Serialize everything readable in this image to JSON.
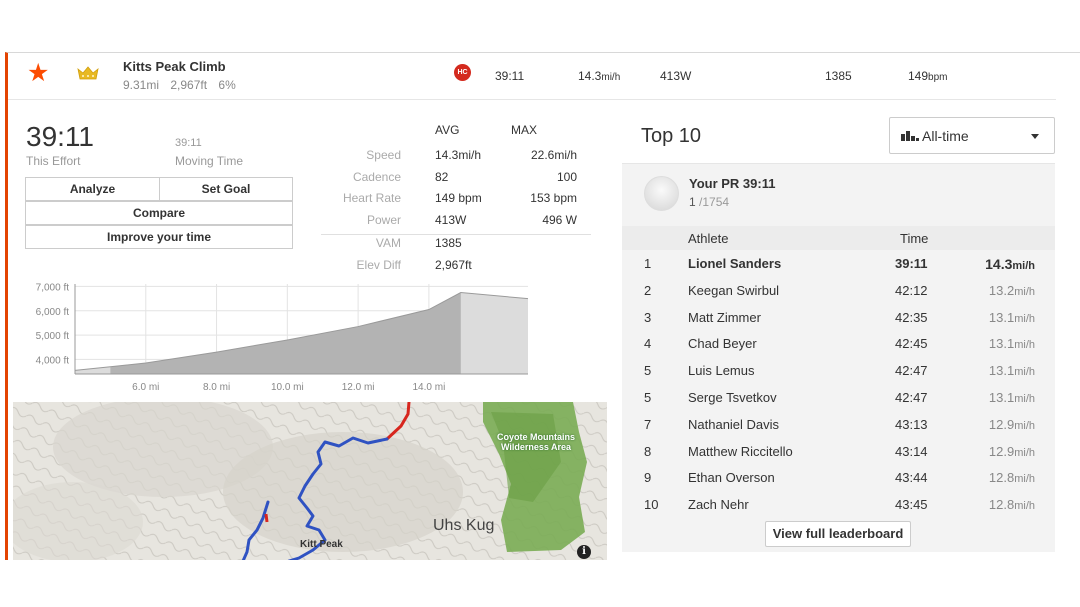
{
  "segment": {
    "name": "Kitts Peak Climb",
    "distance": "9.31mi",
    "elevation": "2,967ft",
    "grade": "6%",
    "category_badge": "HC",
    "time": "39:11",
    "speed": "14.3",
    "speed_unit": "mi/h",
    "power": "413W",
    "vam": "1385",
    "heart_rate": "149",
    "heart_rate_unit": "bpm",
    "colors": {
      "accent": "#fc4c02",
      "crown": "#e8b923",
      "hc": "#d42a1e"
    }
  },
  "effort": {
    "time": "39:11",
    "time_label": "This Effort",
    "moving_time": "39:11",
    "moving_label": "Moving Time"
  },
  "buttons": {
    "analyze": "Analyze",
    "set_goal": "Set Goal",
    "compare": "Compare",
    "improve": "Improve your time"
  },
  "stats": {
    "avg_header": "AVG",
    "max_header": "MAX",
    "rows": [
      {
        "label": "Speed",
        "avg": "14.3mi/h",
        "max": "22.6mi/h"
      },
      {
        "label": "Cadence",
        "avg": "82",
        "max": "100"
      },
      {
        "label": "Heart Rate",
        "avg": "149 bpm",
        "max": "153 bpm"
      },
      {
        "label": "Power",
        "avg": "413W",
        "max": "496 W"
      },
      {
        "label": "VAM",
        "avg": "1385",
        "max": ""
      },
      {
        "label": "Elev Diff",
        "avg": "2,967ft",
        "max": ""
      }
    ]
  },
  "chart_data": {
    "type": "area",
    "title": "",
    "xlabel": "",
    "ylabel": "",
    "y_ticks": [
      "7,000 ft",
      "6,000 ft",
      "5,000 ft",
      "4,000 ft"
    ],
    "x_ticks": [
      "6.0 mi",
      "8.0 mi",
      "10.0 mi",
      "12.0 mi",
      "14.0 mi"
    ],
    "ylim": [
      3400,
      7100
    ],
    "xlim": [
      4.0,
      16.8
    ],
    "x": [
      4.0,
      5.0,
      6.0,
      8.0,
      10.0,
      12.0,
      14.0,
      14.9,
      16.4,
      16.8
    ],
    "y": [
      3550,
      3700,
      3850,
      4300,
      4800,
      5350,
      6050,
      6750,
      6550,
      6500
    ],
    "segment_range": [
      5.0,
      14.9
    ],
    "grid": true
  },
  "map": {
    "place_label": "Uhs Kug",
    "peak_label": "Kitt Peak",
    "wilderness_label": "Coyote Mountains Wilderness Area",
    "info_icon": "info-icon"
  },
  "leaderboard": {
    "title": "Top 10",
    "range_value": "All-time",
    "pr_title": "Your PR 39:11",
    "pr_rank": "1",
    "pr_total": "/1754",
    "col_athlete": "Athlete",
    "col_time": "Time",
    "rows": [
      {
        "rank": "1",
        "name": "Lionel Sanders",
        "time": "39:11",
        "speed": "14.3",
        "unit": "mi/h"
      },
      {
        "rank": "2",
        "name": "Keegan Swirbul",
        "time": "42:12",
        "speed": "13.2",
        "unit": "mi/h"
      },
      {
        "rank": "3",
        "name": "Matt Zimmer",
        "time": "42:35",
        "speed": "13.1",
        "unit": "mi/h"
      },
      {
        "rank": "4",
        "name": "Chad Beyer",
        "time": "42:45",
        "speed": "13.1",
        "unit": "mi/h"
      },
      {
        "rank": "5",
        "name": "Luis Lemus",
        "time": "42:47",
        "speed": "13.1",
        "unit": "mi/h"
      },
      {
        "rank": "5",
        "name": "Serge Tsvetkov",
        "time": "42:47",
        "speed": "13.1",
        "unit": "mi/h"
      },
      {
        "rank": "7",
        "name": "Nathaniel Davis",
        "time": "43:13",
        "speed": "12.9",
        "unit": "mi/h"
      },
      {
        "rank": "8",
        "name": "Matthew Riccitello",
        "time": "43:14",
        "speed": "12.9",
        "unit": "mi/h"
      },
      {
        "rank": "9",
        "name": "Ethan Overson",
        "time": "43:44",
        "speed": "12.8",
        "unit": "mi/h"
      },
      {
        "rank": "10",
        "name": "Zach Nehr",
        "time": "43:45",
        "speed": "12.8",
        "unit": "mi/h"
      }
    ],
    "view_full": "View full leaderboard"
  }
}
